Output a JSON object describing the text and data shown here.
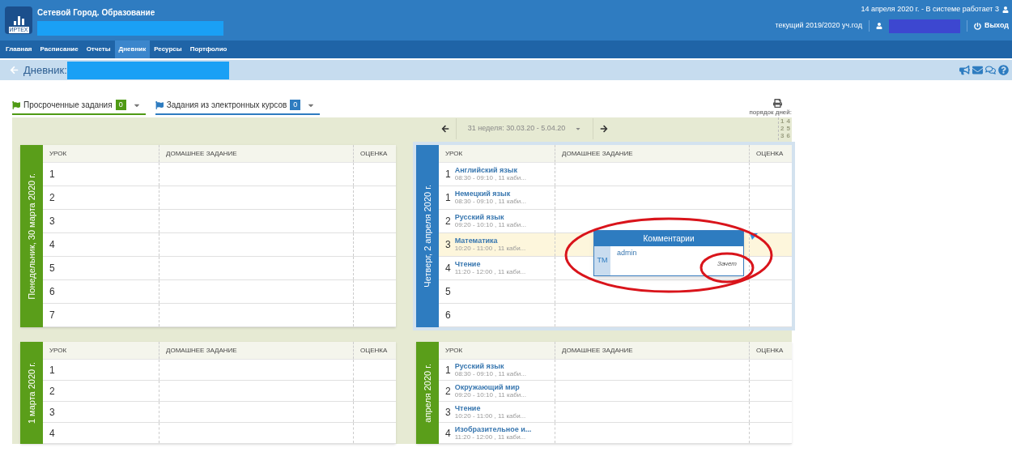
{
  "header": {
    "logo_text": "ИРТЕХ",
    "title": "Сетевой Город. Образование",
    "status": "14 апреля 2020 г. - В системе работает 3",
    "school_year": "текущий 2019/2020 уч.год",
    "logout": "Выход"
  },
  "nav": [
    {
      "label": "Главная",
      "selected": false
    },
    {
      "label": "Расписание",
      "selected": false
    },
    {
      "label": "Отчеты",
      "selected": false
    },
    {
      "label": "Дневник",
      "selected": true
    },
    {
      "label": "Ресурсы",
      "selected": false
    },
    {
      "label": "Портфолио",
      "selected": false
    }
  ],
  "page_title": "Дневник:",
  "filters": [
    {
      "label": "Просроченные задания",
      "count": "0",
      "color": "#4f9a14"
    },
    {
      "label": "Задания из электронных курсов",
      "count": "0",
      "color": "#2e7cc0"
    }
  ],
  "week": "31 неделя: 30.03.20 - 5.04.20",
  "day_order_label": "порядок дней:",
  "day_order": [
    "1",
    "4",
    "2",
    "5",
    "3",
    "6"
  ],
  "days": [
    {
      "label": "Понедельник, 30 марта 2020 г.",
      "selected": false,
      "columns": [
        "УРОК",
        "ДОМАШНЕЕ ЗАДАНИЕ",
        "ОЦЕНКА"
      ],
      "lessons": [
        {
          "number": "1",
          "highlighted": false,
          "commented": false
        },
        {
          "number": "2",
          "highlighted": false,
          "commented": false
        },
        {
          "number": "3",
          "highlighted": false,
          "commented": false
        },
        {
          "number": "4",
          "highlighted": false,
          "commented": false
        },
        {
          "number": "5",
          "highlighted": false,
          "commented": false
        },
        {
          "number": "6",
          "highlighted": false,
          "commented": false
        },
        {
          "number": "7",
          "highlighted": false,
          "commented": false
        }
      ]
    },
    {
      "label": "Четверг, 2 апреля 2020 г.",
      "selected": true,
      "columns": [
        "УРОК",
        "ДОМАШНЕЕ ЗАДАНИЕ",
        "ОЦЕНКА"
      ],
      "lessons": [
        {
          "number": "1",
          "subject": "Английский язык",
          "time": "08:30 - 09:10 , 11 каби...",
          "highlighted": false,
          "commented": false
        },
        {
          "number": "1",
          "subject": "Немецкий язык",
          "time": "08:30 - 09:10 , 11 каби...",
          "highlighted": false,
          "commented": false
        },
        {
          "number": "2",
          "subject": "Русский язык",
          "time": "09:20 - 10:10 , 11 каби...",
          "highlighted": false,
          "commented": false
        },
        {
          "number": "3",
          "subject": "Математика",
          "time": "10:20 - 11:00 , 11 каби...",
          "highlighted": true,
          "commented": true
        },
        {
          "number": "4",
          "subject": "Чтение",
          "time": "11:20 - 12:00 , 11 каби...",
          "highlighted": false,
          "commented": false
        },
        {
          "number": "5",
          "highlighted": false,
          "commented": false
        },
        {
          "number": "6",
          "highlighted": false,
          "commented": false
        }
      ]
    },
    {
      "label": "1 марта 2020 г.",
      "selected": false,
      "columns": [
        "УРОК",
        "ДОМАШНЕЕ ЗАДАНИЕ",
        "ОЦЕНКА"
      ],
      "lessons": [
        {
          "number": "1",
          "highlighted": false,
          "commented": false
        },
        {
          "number": "2",
          "highlighted": false,
          "commented": false
        },
        {
          "number": "3",
          "highlighted": false,
          "commented": false
        },
        {
          "number": "4",
          "highlighted": false,
          "commented": false
        }
      ]
    },
    {
      "label": "апреля 2020 г.",
      "selected": false,
      "columns": [
        "УРОК",
        "ДОМАШНЕЕ ЗАДАНИЕ",
        "ОЦЕНКА"
      ],
      "lessons": [
        {
          "number": "1",
          "subject": "Русский язык",
          "time": "08:30 - 09:10 , 11 каби...",
          "highlighted": false,
          "commented": false
        },
        {
          "number": "2",
          "subject": "Окружающий мир",
          "time": "09:20 - 10:10 , 11 каби...",
          "highlighted": false,
          "commented": false
        },
        {
          "number": "3",
          "subject": "Чтение",
          "time": "10:20 - 11:00 , 11 каби...",
          "highlighted": false,
          "commented": false
        },
        {
          "number": "4",
          "subject": "Изобразительное и...",
          "time": "11:20 - 12:00 , 11 каби...",
          "highlighted": false,
          "commented": false
        }
      ]
    }
  ],
  "comment": {
    "title": "Комментарии",
    "initials": "ТМ",
    "author": "admin",
    "text": "Зачет"
  }
}
